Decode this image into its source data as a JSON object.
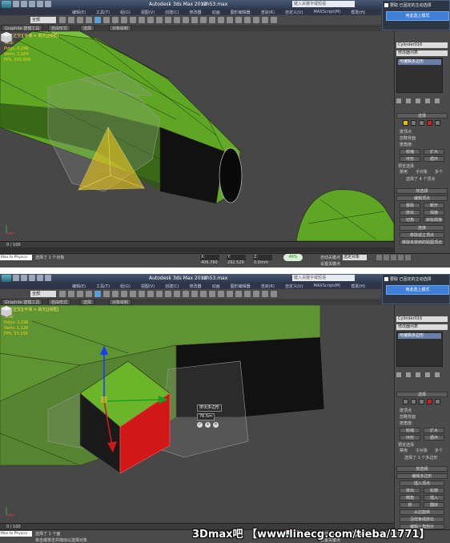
{
  "app": {
    "title": "Autodesk 3ds Max 2012",
    "filename": "mh53.max",
    "search_placeholder": "键入关键字或短语"
  },
  "menus": [
    "编辑(E)",
    "工具(T)",
    "组(G)",
    "视图(V)",
    "创建(C)",
    "修改器",
    "动画",
    "图形编辑器",
    "渲染(R)",
    "自定义(U)",
    "MAXScript(M)",
    "帮助(H)"
  ],
  "toolbar": {
    "selection_filter": "全部"
  },
  "ribbon_tabs": [
    "Graphite 建模工具",
    "自由形式",
    "选择",
    "对象绘制"
  ],
  "popup": {
    "header": "要取 已固定的主动选择",
    "button": "用此选上模式"
  },
  "shot_a": {
    "viewport_label": "[ + ][正交][平滑 + 高光][线框]",
    "stats": [
      "Total",
      "Polys: 4,296",
      "Verts: 2,164",
      "FPS: 103.909"
    ],
    "object_name": "Cylinder016",
    "modifier_list": "修改器列表",
    "stack_item": "可编辑多边形",
    "selection_head": "选择",
    "selection_rows": [
      "按顶点",
      "忽略背面",
      "按角度:",
      "收缩",
      "扩大",
      "环形",
      "循环"
    ],
    "preview_label": "预览选择",
    "preview_options": [
      "禁用",
      "子对象",
      "多个"
    ],
    "selection_status": "选择了 4 个顶点",
    "soft_selection": "软选择",
    "edit_head": "编辑顶点",
    "edit_buttons": [
      "移除",
      "断开",
      "挤出",
      "焊接",
      "切角",
      "目标焊接",
      "连接",
      "移除孤立顶点",
      "移除未使用的贴图顶点"
    ],
    "frame": "0 / 100",
    "status_msg": "选择了 1 个对象",
    "maxscript": "Max to Physics",
    "coords": [
      "X: 406.760",
      "Y: 292.529",
      "Z: 0.0mm"
    ],
    "speed": [
      "0K/S",
      "0K/S"
    ],
    "autokey": "自动关键点",
    "setkey": "设置关键点",
    "key_filter": "关键点过滤器",
    "sel_mode": "选定对象",
    "percent": "46%"
  },
  "shot_b": {
    "viewport_label": "[ + ][正交][平滑 + 高光][线框]",
    "stats": [
      "Total",
      "Polys: 2,196",
      "Verts: 1,128",
      "FPS: 53.156"
    ],
    "object_name": "Cylinder016",
    "modifier_list": "修改器列表",
    "stack_item": "可编辑多边形",
    "selection_head": "选择",
    "selection_rows": [
      "按顶点",
      "忽略背面",
      "按角度:",
      "收缩",
      "扩大",
      "环形",
      "循环"
    ],
    "preview_label": "预览选择",
    "preview_options": [
      "禁用",
      "子对象",
      "多个"
    ],
    "selection_status": "选择了 1 个多边形",
    "soft_selection": "软选择",
    "edit_head": "编辑多边形",
    "edit_sub_head": "插入顶点",
    "edit_buttons": [
      "挤出",
      "轮廓",
      "倒角",
      "插入",
      "桥",
      "翻转",
      "从边旋转",
      "沿样条线挤出",
      "编辑三角剖分"
    ],
    "spinner_value": "挤出多边形",
    "spinner_amount": "76.5m",
    "frame": "0 / 100",
    "status_msg": "选择了 1 个面",
    "status_msg2": "单击或单击并拖动以选择对象",
    "maxscript": "Max to Physics",
    "speed": [
      "0K/S",
      "0K/S"
    ],
    "autokey": "自动关键点",
    "setkey": "设置关键点",
    "key_filter": "关键点过滤器",
    "sel_mode": "选定对象",
    "percent": "46%"
  },
  "watermark": "3Dmax吧 【www.linecg.com/tieba/1771】",
  "colors": {
    "model_green": "#6ab52a",
    "selection_yellow": "#e0c020",
    "selection_red": "#d01818",
    "gizmo_blue": "#1a3cff",
    "gizmo_green": "#1aa01a",
    "viewport_bg": "#474747"
  }
}
